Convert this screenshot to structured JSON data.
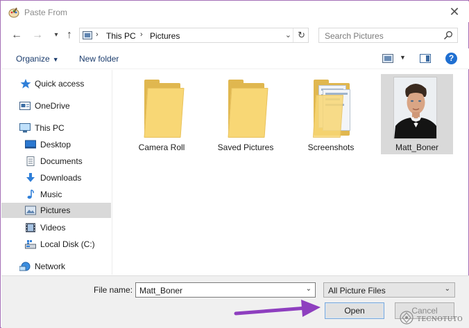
{
  "window": {
    "title": "Paste From"
  },
  "navigation": {
    "breadcrumb": [
      "This PC",
      "Pictures"
    ],
    "search_placeholder": "Search Pictures"
  },
  "commands": {
    "organize": "Organize",
    "new_folder": "New folder"
  },
  "sidebar": {
    "items": [
      {
        "label": "Quick access",
        "icon": "star-icon"
      },
      {
        "label": "OneDrive",
        "icon": "onedrive-icon"
      },
      {
        "label": "This PC",
        "icon": "computer-icon"
      },
      {
        "label": "Desktop",
        "icon": "desktop-icon"
      },
      {
        "label": "Documents",
        "icon": "documents-icon"
      },
      {
        "label": "Downloads",
        "icon": "downloads-icon"
      },
      {
        "label": "Music",
        "icon": "music-icon"
      },
      {
        "label": "Pictures",
        "icon": "pictures-icon",
        "selected": true
      },
      {
        "label": "Videos",
        "icon": "videos-icon"
      },
      {
        "label": "Local Disk (C:)",
        "icon": "disk-icon"
      },
      {
        "label": "Network",
        "icon": "network-icon"
      }
    ]
  },
  "files": [
    {
      "name": "Camera Roll",
      "type": "folder"
    },
    {
      "name": "Saved Pictures",
      "type": "folder"
    },
    {
      "name": "Screenshots",
      "type": "folder-with-documents"
    },
    {
      "name": "Matt_Boner",
      "type": "image",
      "selected": true
    }
  ],
  "footer": {
    "filename_label": "File name:",
    "filename_value": "Matt_Boner",
    "filter_value": "All Picture Files",
    "open_label": "Open",
    "cancel_label": "Cancel"
  },
  "watermark": {
    "text": "TECNOTUTO"
  },
  "colors": {
    "accent": "#1f6fd1",
    "folder": "#f8d775",
    "selection": "#d9d9d9",
    "arrow": "#8e3fbf",
    "frame": "#a46fb6"
  }
}
